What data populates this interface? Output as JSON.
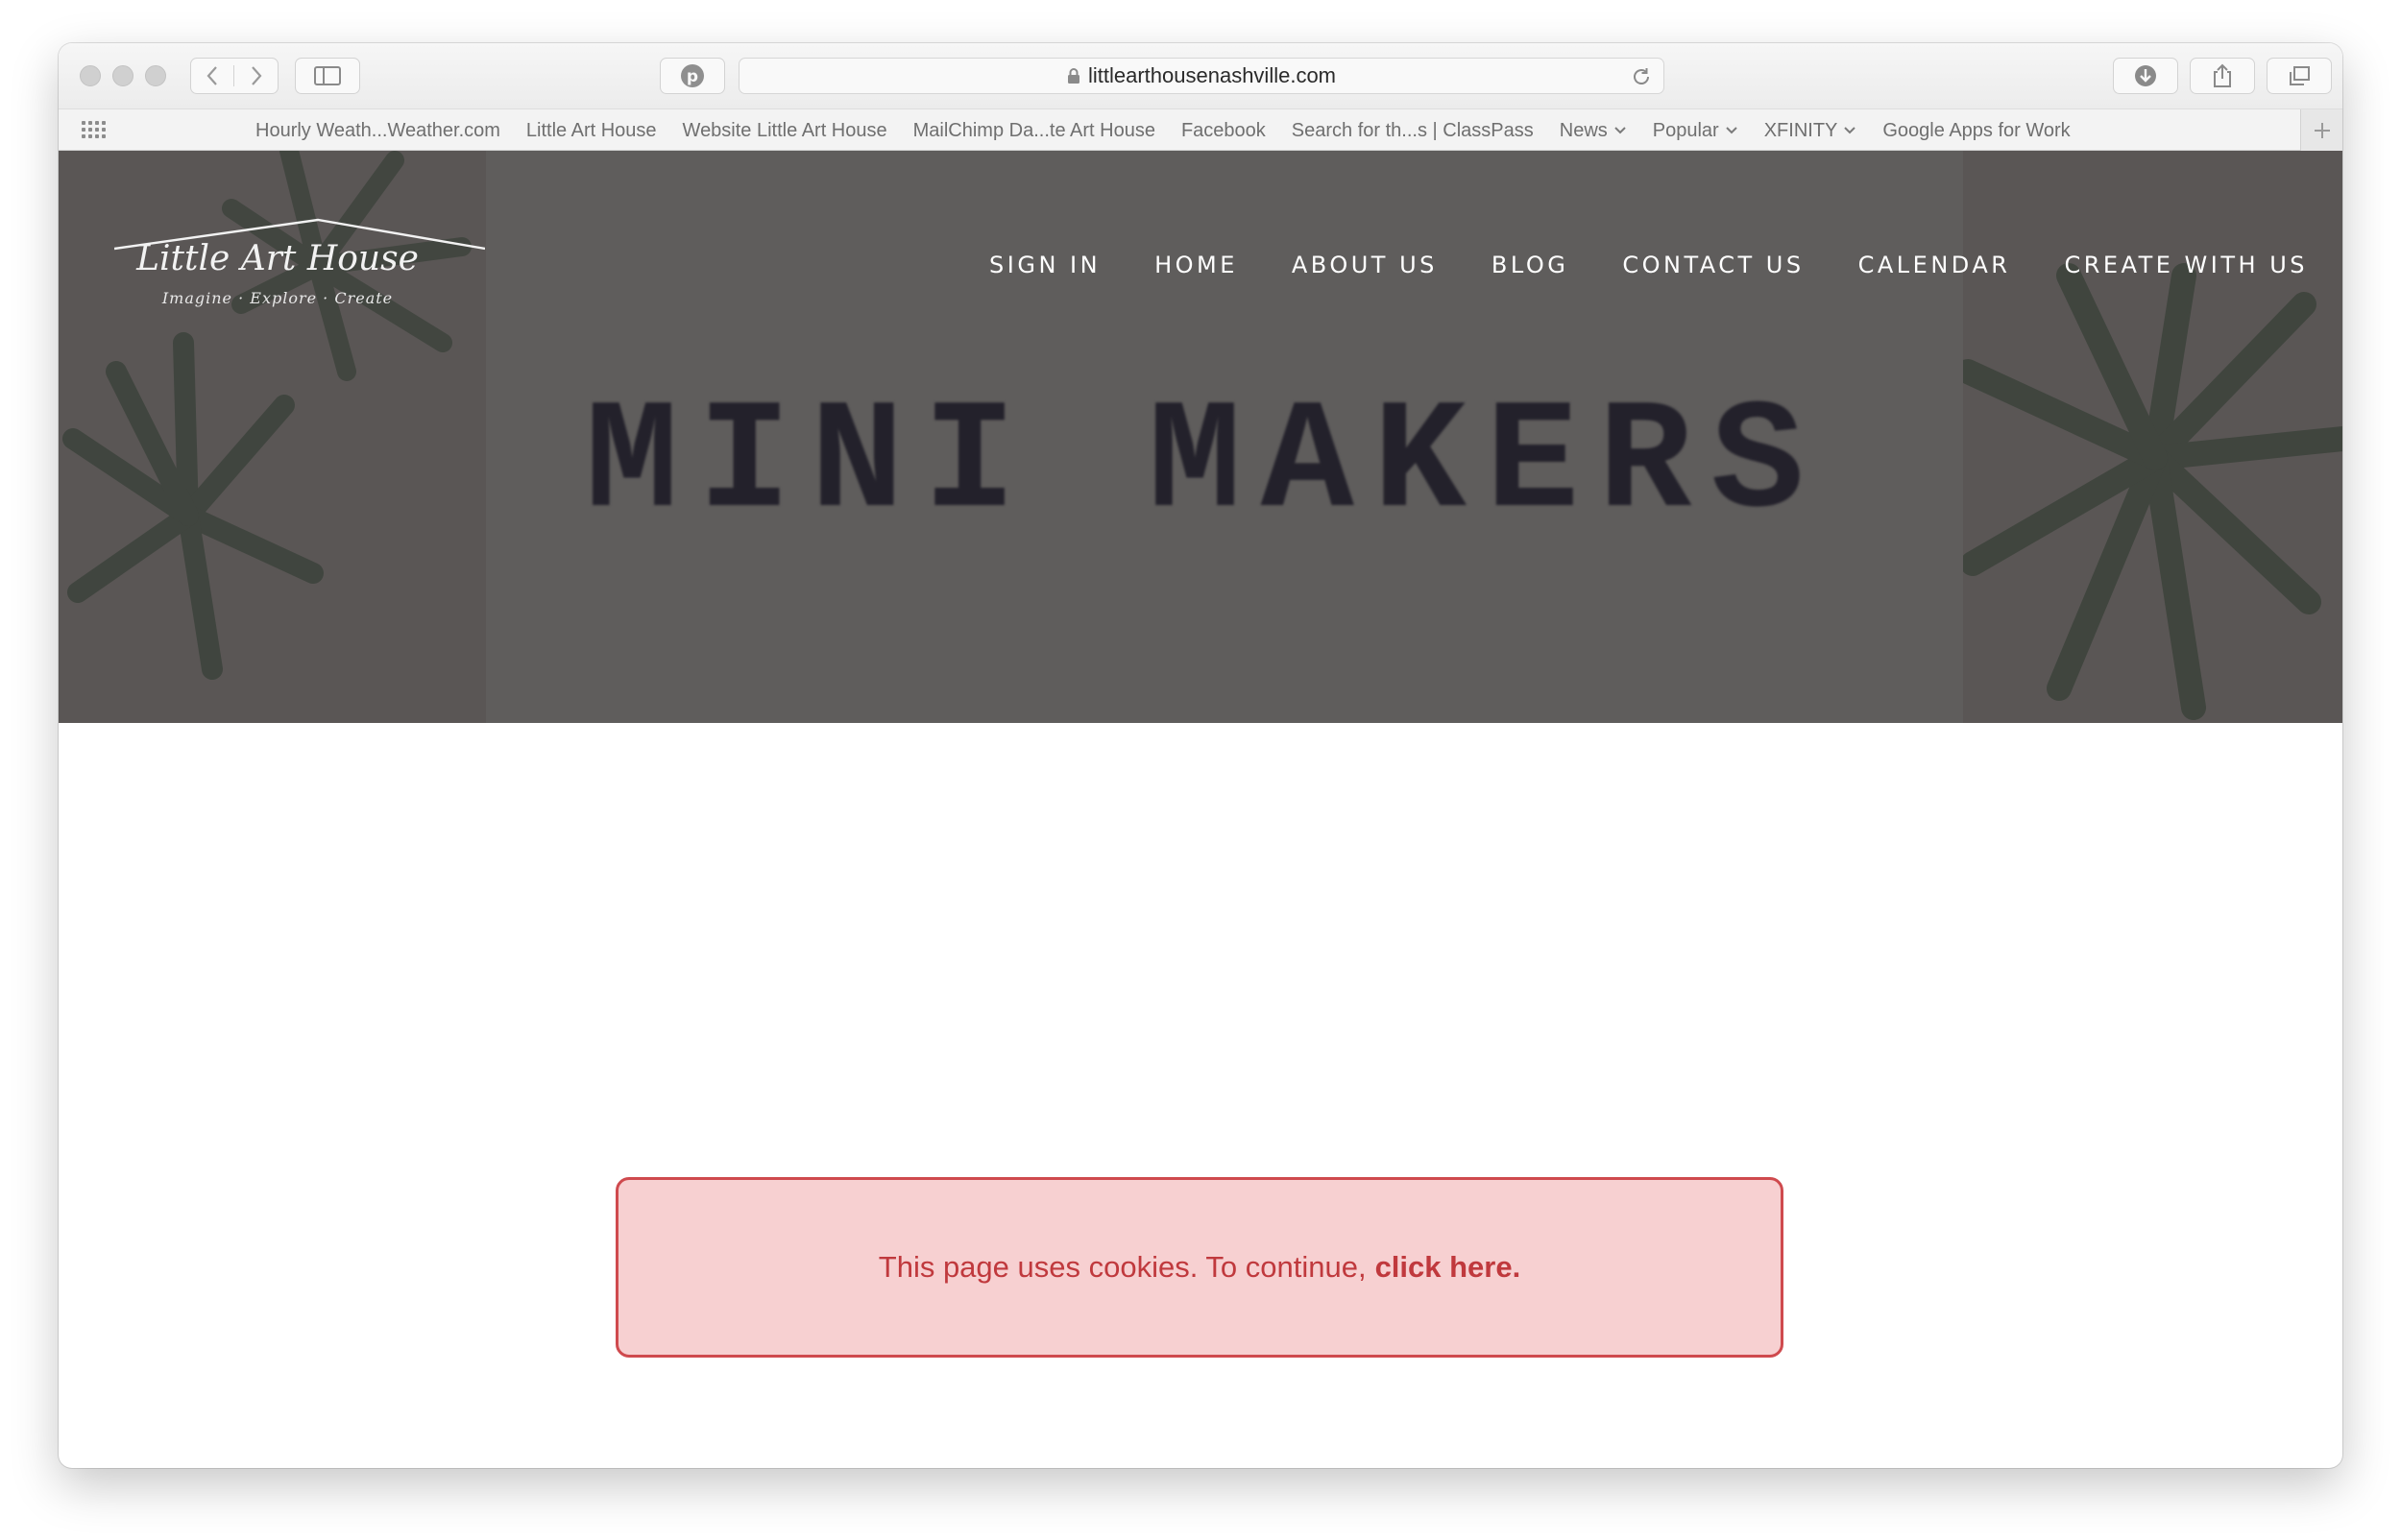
{
  "browser": {
    "url": "littlearthousenashville.com",
    "bookmarks": [
      {
        "label": "Hourly Weath...Weather.com",
        "dropdown": false
      },
      {
        "label": "Little Art House",
        "dropdown": false
      },
      {
        "label": "Website Little Art House",
        "dropdown": false
      },
      {
        "label": "MailChimp Da...te Art House",
        "dropdown": false
      },
      {
        "label": "Facebook",
        "dropdown": false
      },
      {
        "label": "Search for th...s | ClassPass",
        "dropdown": false
      },
      {
        "label": "News",
        "dropdown": true
      },
      {
        "label": "Popular",
        "dropdown": true
      },
      {
        "label": "XFINITY",
        "dropdown": true
      },
      {
        "label": "Google Apps for Work",
        "dropdown": false
      }
    ]
  },
  "site": {
    "logo_name": "Little Art House",
    "logo_tagline": "Imagine · Explore · Create",
    "nav": [
      "SIGN IN",
      "HOME",
      "ABOUT US",
      "BLOG",
      "CONTACT US",
      "CALENDAR",
      "CREATE WITH US"
    ],
    "hero_title": "MINI MAKERS",
    "colors": {
      "hero_bg": "#5f5d5c",
      "hero_title": "#23212b",
      "cookie_bg": "#f7d0d1",
      "cookie_text": "#c0393d"
    }
  },
  "cookie_banner": {
    "message": "This page uses cookies. To continue,",
    "link_text": "click here."
  }
}
